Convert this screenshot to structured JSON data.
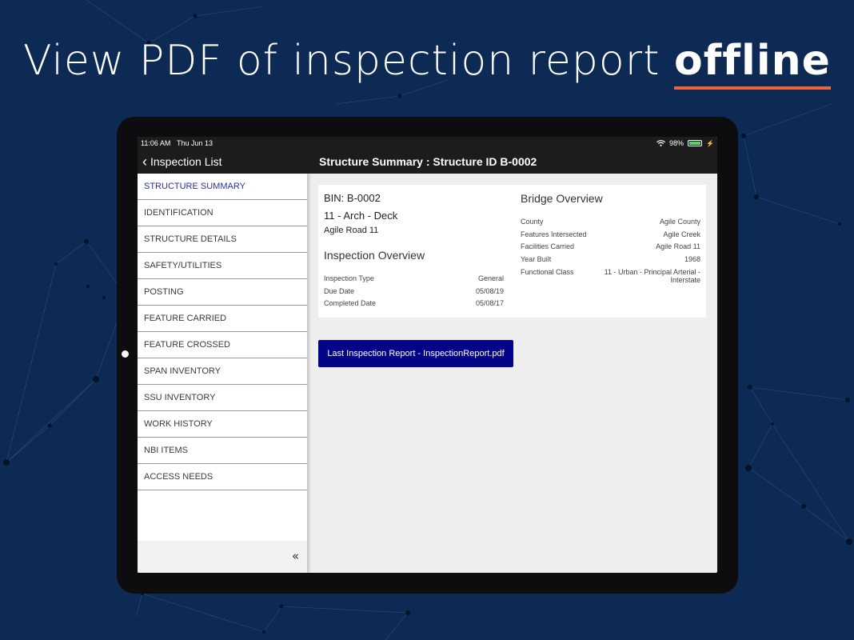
{
  "headline": {
    "text": "View PDF of inspection report ",
    "strong": "offline"
  },
  "colors": {
    "background": "#0c2a54",
    "accent_underline": "#e8663a",
    "button": "#040488",
    "active_menu": "#2b2fa0"
  },
  "status_bar": {
    "time": "11:06 AM",
    "date": "Thu Jun 13",
    "battery": "98%",
    "battery_level": 0.98
  },
  "nav": {
    "back_label": "Inspection List",
    "title": "Structure Summary : Structure ID B-0002"
  },
  "sidebar": {
    "items": [
      {
        "label": "STRUCTURE SUMMARY",
        "active": true
      },
      {
        "label": "IDENTIFICATION"
      },
      {
        "label": "STRUCTURE DETAILS"
      },
      {
        "label": "SAFETY/UTILITIES"
      },
      {
        "label": "POSTING"
      },
      {
        "label": "FEATURE CARRIED"
      },
      {
        "label": "FEATURE CROSSED"
      },
      {
        "label": "SPAN INVENTORY"
      },
      {
        "label": "SSU INVENTORY"
      },
      {
        "label": "WORK HISTORY"
      },
      {
        "label": "NBI ITEMS"
      },
      {
        "label": "ACCESS NEEDS"
      }
    ],
    "collapse_label": "«"
  },
  "summary": {
    "bin": "BIN: B-0002",
    "type": "11 - Arch - Deck",
    "road": "Agile Road 11",
    "inspection_title": "Inspection Overview",
    "inspection": [
      {
        "label": "Inspection Type",
        "value": "General"
      },
      {
        "label": "Due Date",
        "value": "05/08/19"
      },
      {
        "label": "Completed Date",
        "value": "05/08/17"
      }
    ],
    "bridge_title": "Bridge Overview",
    "bridge": [
      {
        "label": "County",
        "value": "Agile County"
      },
      {
        "label": "Features Intersected",
        "value": "Agile Creek"
      },
      {
        "label": "Facilities Carried",
        "value": "Agile Road 11"
      },
      {
        "label": "Year Built",
        "value": "1968"
      },
      {
        "label": "Functional Class",
        "value": "11 - Urban - Principal Arterial - Interstate"
      }
    ]
  },
  "pdf_button": {
    "label": "Last Inspection Report - InspectionReport.pdf"
  }
}
